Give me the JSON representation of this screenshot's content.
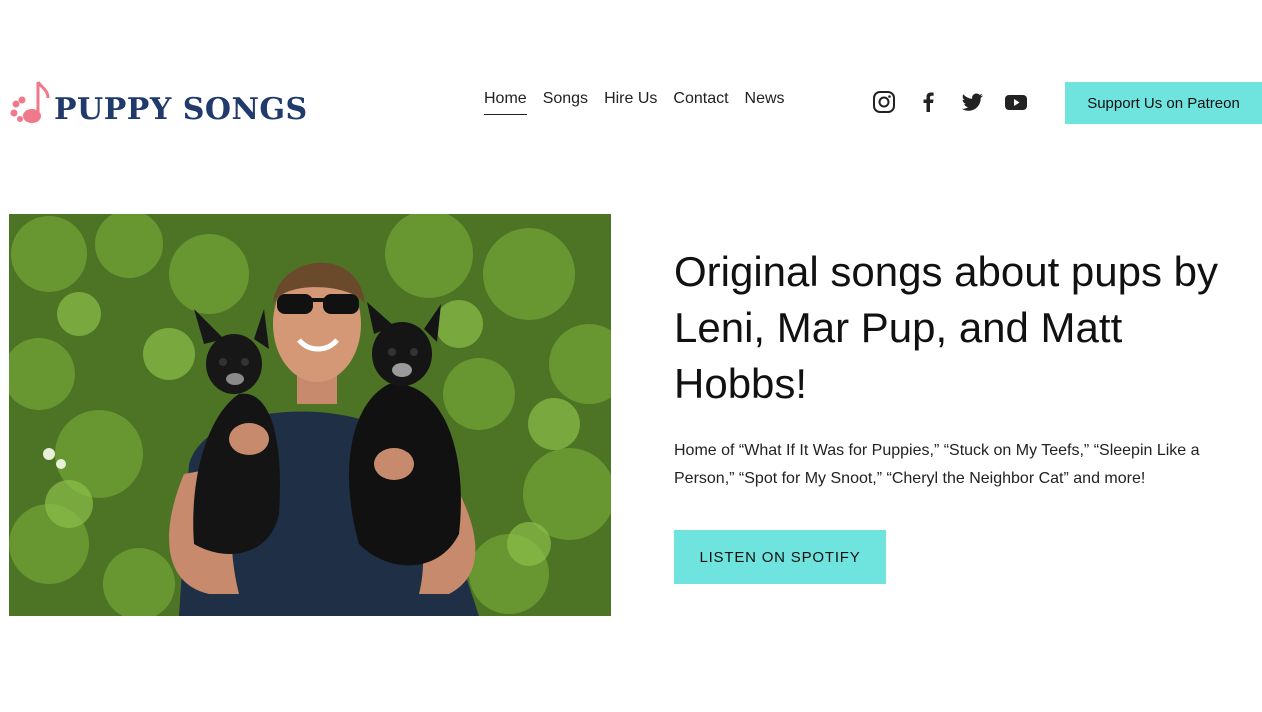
{
  "header": {
    "logo_text": "PUPPY SONGS",
    "nav": [
      {
        "label": "Home",
        "active": true
      },
      {
        "label": "Songs",
        "active": false
      },
      {
        "label": "Hire Us",
        "active": false
      },
      {
        "label": "Contact",
        "active": false
      },
      {
        "label": "News",
        "active": false
      }
    ],
    "social_icons": [
      "instagram-icon",
      "facebook-icon",
      "twitter-icon",
      "youtube-icon"
    ],
    "patreon_label": "Support Us on Patreon"
  },
  "hero": {
    "headline": "Original songs about pups by Leni, Mar Pup, and Matt Hobbs!",
    "subtext": "Home of “What If It Was for Puppies,” “Stuck on My Teefs,” “Sleepin Like a Person,” “Spot for My Snoot,” “Cheryl the Neighbor Cat” and more!",
    "cta_label": "LISTEN ON SPOTIFY"
  },
  "colors": {
    "accent": "#6fe3dd",
    "logo_blue": "#1f3a6b",
    "logo_pink": "#f07a8c"
  }
}
